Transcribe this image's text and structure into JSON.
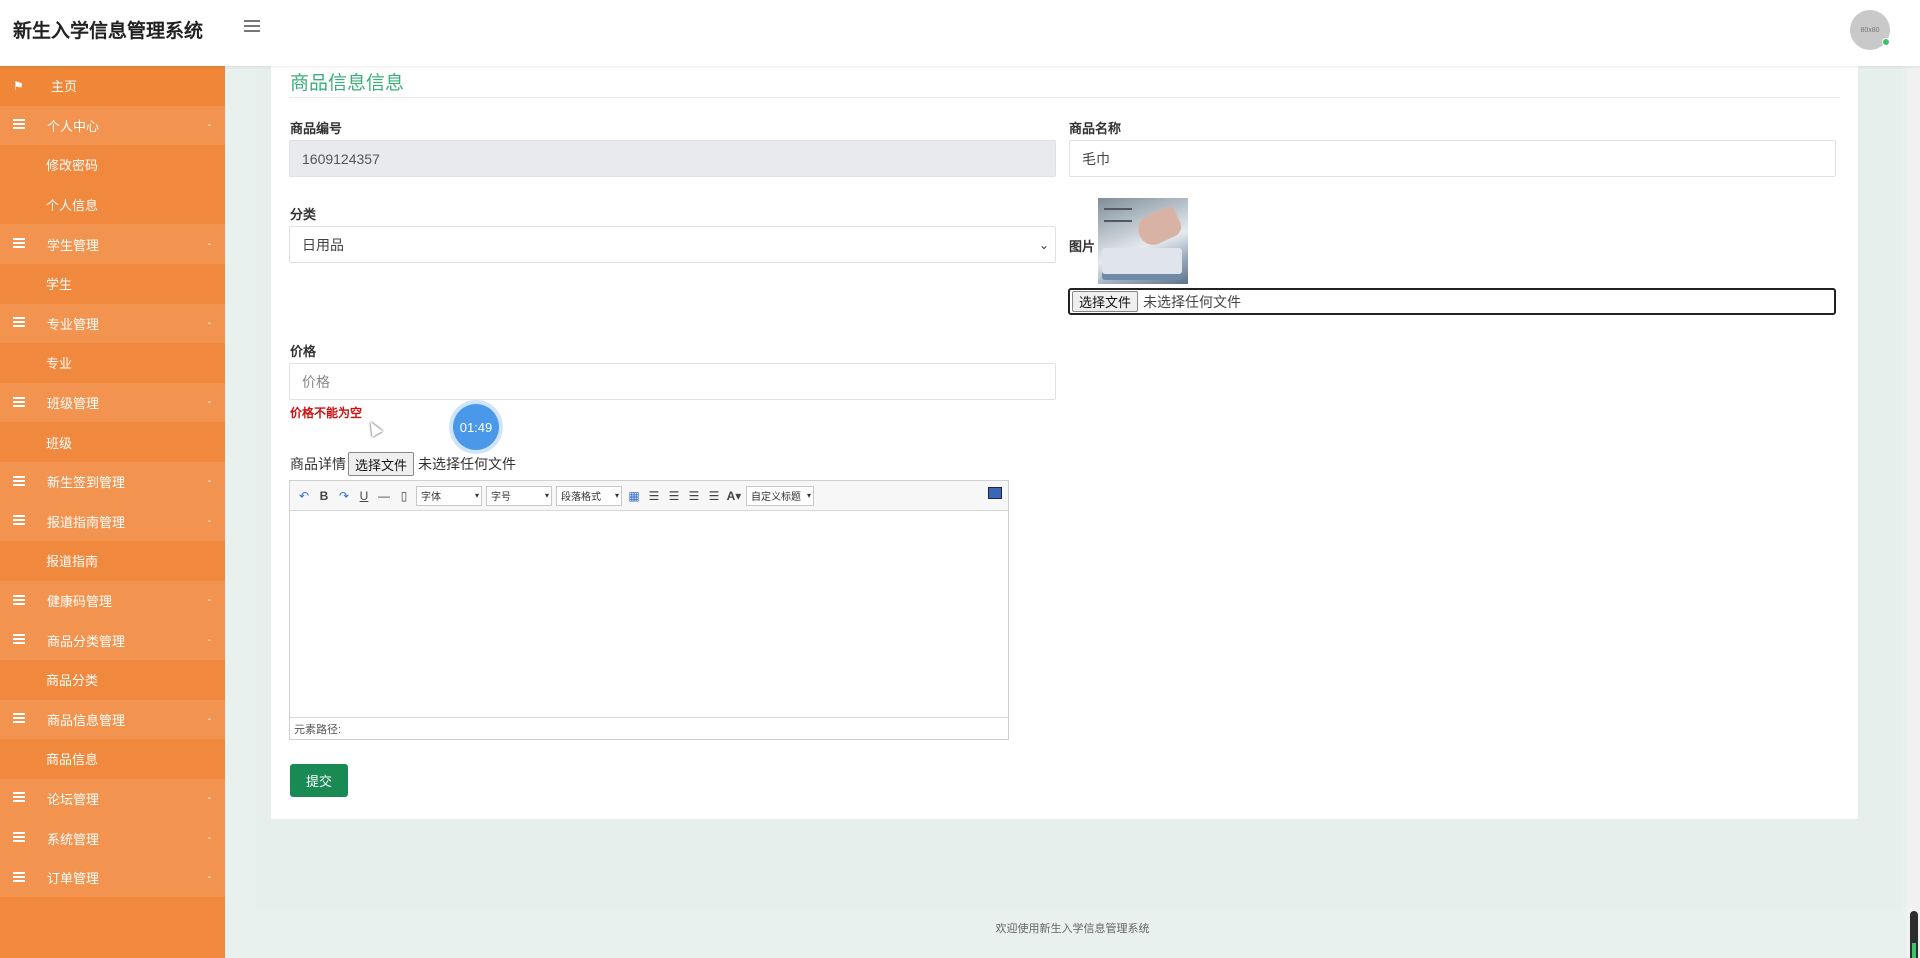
{
  "header": {
    "app_title": "新生入学信息管理系统",
    "avatar_text": "80x80"
  },
  "sidebar": {
    "items": [
      {
        "label": "主页",
        "type": "home"
      },
      {
        "label": "个人中心",
        "type": "parent",
        "caret": "-"
      },
      {
        "label": "修改密码",
        "type": "child"
      },
      {
        "label": "个人信息",
        "type": "child"
      },
      {
        "label": "学生管理",
        "type": "parent",
        "caret": "-"
      },
      {
        "label": "学生",
        "type": "child"
      },
      {
        "label": "专业管理",
        "type": "parent",
        "caret": "-"
      },
      {
        "label": "专业",
        "type": "child"
      },
      {
        "label": "班级管理",
        "type": "parent",
        "caret": "-"
      },
      {
        "label": "班级",
        "type": "child"
      },
      {
        "label": "新生签到管理",
        "type": "parent",
        "caret": "-"
      },
      {
        "label": "报道指南管理",
        "type": "parent",
        "caret": "-"
      },
      {
        "label": "报道指南",
        "type": "child"
      },
      {
        "label": "健康码管理",
        "type": "parent",
        "caret": "-"
      },
      {
        "label": "商品分类管理",
        "type": "parent",
        "caret": "-"
      },
      {
        "label": "商品分类",
        "type": "child"
      },
      {
        "label": "商品信息管理",
        "type": "parent",
        "caret": "-"
      },
      {
        "label": "商品信息",
        "type": "child"
      },
      {
        "label": "论坛管理",
        "type": "parent",
        "caret": "-"
      },
      {
        "label": "系统管理",
        "type": "parent",
        "caret": "-"
      },
      {
        "label": "订单管理",
        "type": "parent",
        "caret": "-"
      }
    ]
  },
  "form": {
    "section_title": "商品信息信息",
    "product_no_label": "商品编号",
    "product_no_value": "1609124357",
    "product_name_label": "商品名称",
    "product_name_value": "毛巾",
    "category_label": "分类",
    "category_value": "日用品",
    "image_label": "图片",
    "image_file_button": "选择文件",
    "image_file_text": "未选择任何文件",
    "price_label": "价格",
    "price_placeholder": "价格",
    "price_error": "价格不能为空",
    "detail_label": "商品详情",
    "detail_file_button": "选择文件",
    "detail_file_text": "未选择任何文件",
    "submit_label": "提交"
  },
  "editor": {
    "font_select": "字体",
    "size_select": "字号",
    "para_select": "段落格式",
    "custom_title_select": "自定义标题",
    "path_label": "元素路径:"
  },
  "overlay": {
    "timer_text": "01:49"
  },
  "footer": {
    "text": "欢迎使用新生入学信息管理系统"
  }
}
